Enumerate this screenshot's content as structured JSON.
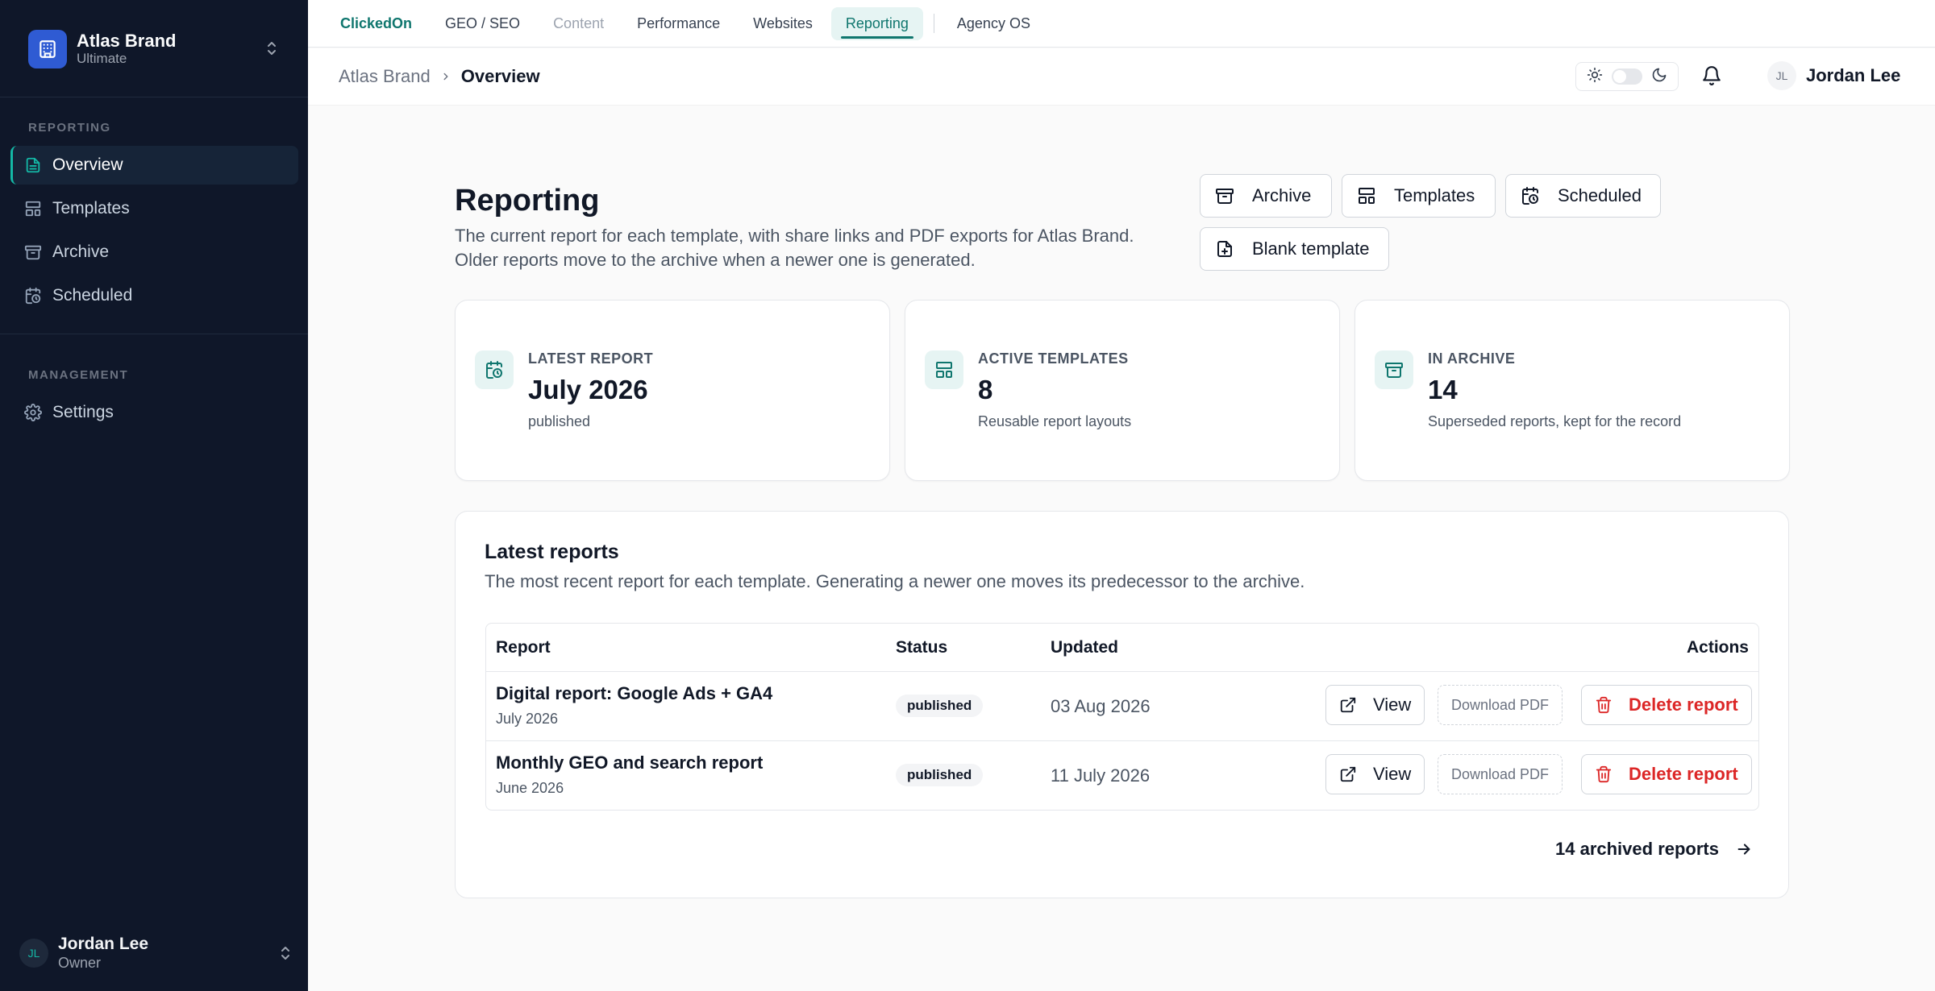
{
  "sidebar": {
    "brand_name": "Atlas Brand",
    "brand_plan": "Ultimate",
    "section_reporting": "REPORTING",
    "section_management": "MANAGEMENT",
    "items": [
      {
        "label": "Overview",
        "icon": "document-icon",
        "active": true
      },
      {
        "label": "Templates",
        "icon": "layout-icon",
        "active": false
      },
      {
        "label": "Archive",
        "icon": "archive-icon",
        "active": false
      },
      {
        "label": "Scheduled",
        "icon": "calendar-clock-icon",
        "active": false
      }
    ],
    "management_items": [
      {
        "label": "Settings",
        "icon": "gear-icon"
      }
    ],
    "user": {
      "initials": "JL",
      "name": "Jordan Lee",
      "role": "Owner"
    }
  },
  "topnav": {
    "brand": "ClickedOn",
    "tabs": [
      "GEO / SEO",
      "Content",
      "Performance",
      "Websites",
      "Reporting"
    ],
    "active_tab": "Reporting",
    "extra": "Agency OS"
  },
  "header": {
    "breadcrumb_parent": "Atlas Brand",
    "breadcrumb_current": "Overview",
    "user_initials": "JL",
    "user_name": "Jordan Lee"
  },
  "main": {
    "title": "Reporting",
    "description_line1": "The current report for each template, with share links and PDF exports for Atlas Brand.",
    "description_line2": "Older reports move to the archive when a newer one is generated.",
    "buttons": {
      "archive": "Archive",
      "templates": "Templates",
      "scheduled": "Scheduled",
      "blank_template": "Blank template"
    },
    "stats": [
      {
        "label": "LATEST REPORT",
        "value": "July 2026",
        "sub": "published",
        "icon": "calendar-clock-icon"
      },
      {
        "label": "ACTIVE TEMPLATES",
        "value": "8",
        "sub": "Reusable report layouts",
        "icon": "layout-icon"
      },
      {
        "label": "IN ARCHIVE",
        "value": "14",
        "sub": "Superseded reports, kept for the record",
        "icon": "archive-icon"
      }
    ],
    "latest": {
      "title": "Latest reports",
      "description": "The most recent report for each template. Generating a newer one moves its predecessor to the archive.",
      "columns": [
        "Report",
        "Status",
        "Updated",
        "Actions"
      ],
      "rows": [
        {
          "name": "Digital report: Google Ads + GA4",
          "period": "July 2026",
          "status": "published",
          "updated": "03 Aug 2026"
        },
        {
          "name": "Monthly GEO and search report",
          "period": "June 2026",
          "status": "published",
          "updated": "11 July 2026"
        }
      ],
      "actions": {
        "view": "View",
        "download": "Download PDF",
        "delete": "Delete report"
      },
      "archived_link": "14 archived reports"
    }
  },
  "colors": {
    "sidebar_bg": "#0f1729",
    "accent": "#0f766e",
    "danger": "#dc2626",
    "brand_logo": "#2f5bd3"
  }
}
